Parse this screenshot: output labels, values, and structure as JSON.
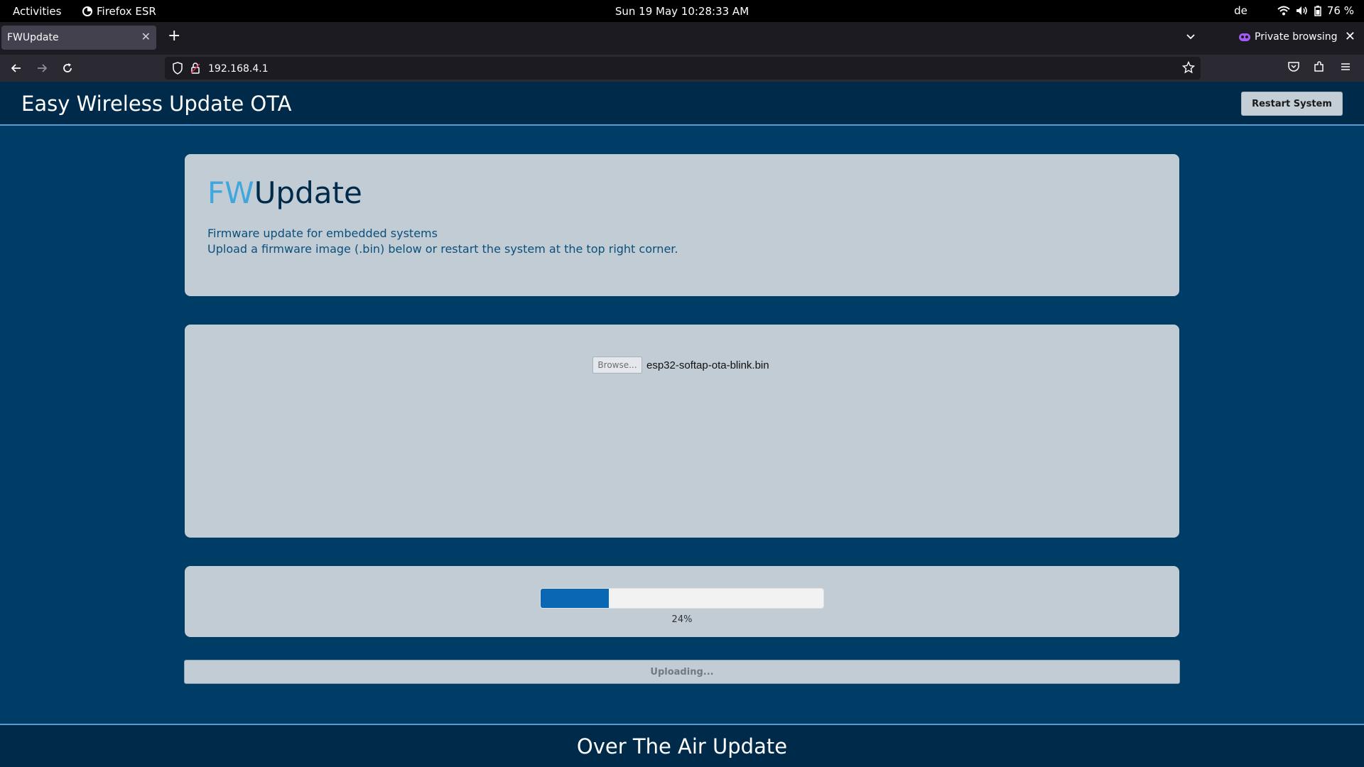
{
  "system_bar": {
    "activities": "Activities",
    "app_name": "Firefox ESR",
    "datetime": "Sun 19 May  10:28:33 AM",
    "language": "de",
    "battery": "76 %"
  },
  "browser": {
    "tab_title": "FWUpdate",
    "private_label": "Private browsing",
    "url": "192.168.4.1"
  },
  "page": {
    "header_title": "Easy Wireless Update OTA",
    "restart_button": "Restart System",
    "hero": {
      "title_accent": "FW",
      "title_rest": "Update",
      "line1": "Firmware update for embedded systems",
      "line2": "Upload a firmware image (.bin) below or restart the system at the top right corner."
    },
    "file_input": {
      "browse_label": "Browse...",
      "file_name": "esp32-softap-ota-blink.bin"
    },
    "progress": {
      "fraction": 0.24,
      "label": "24%"
    },
    "upload_button": "Uploading...",
    "footer_title": "Over The Air Update"
  },
  "colors": {
    "accent": "#3fa7dd",
    "progress_fill": "#0a67b3",
    "page_background": "#003d66"
  }
}
